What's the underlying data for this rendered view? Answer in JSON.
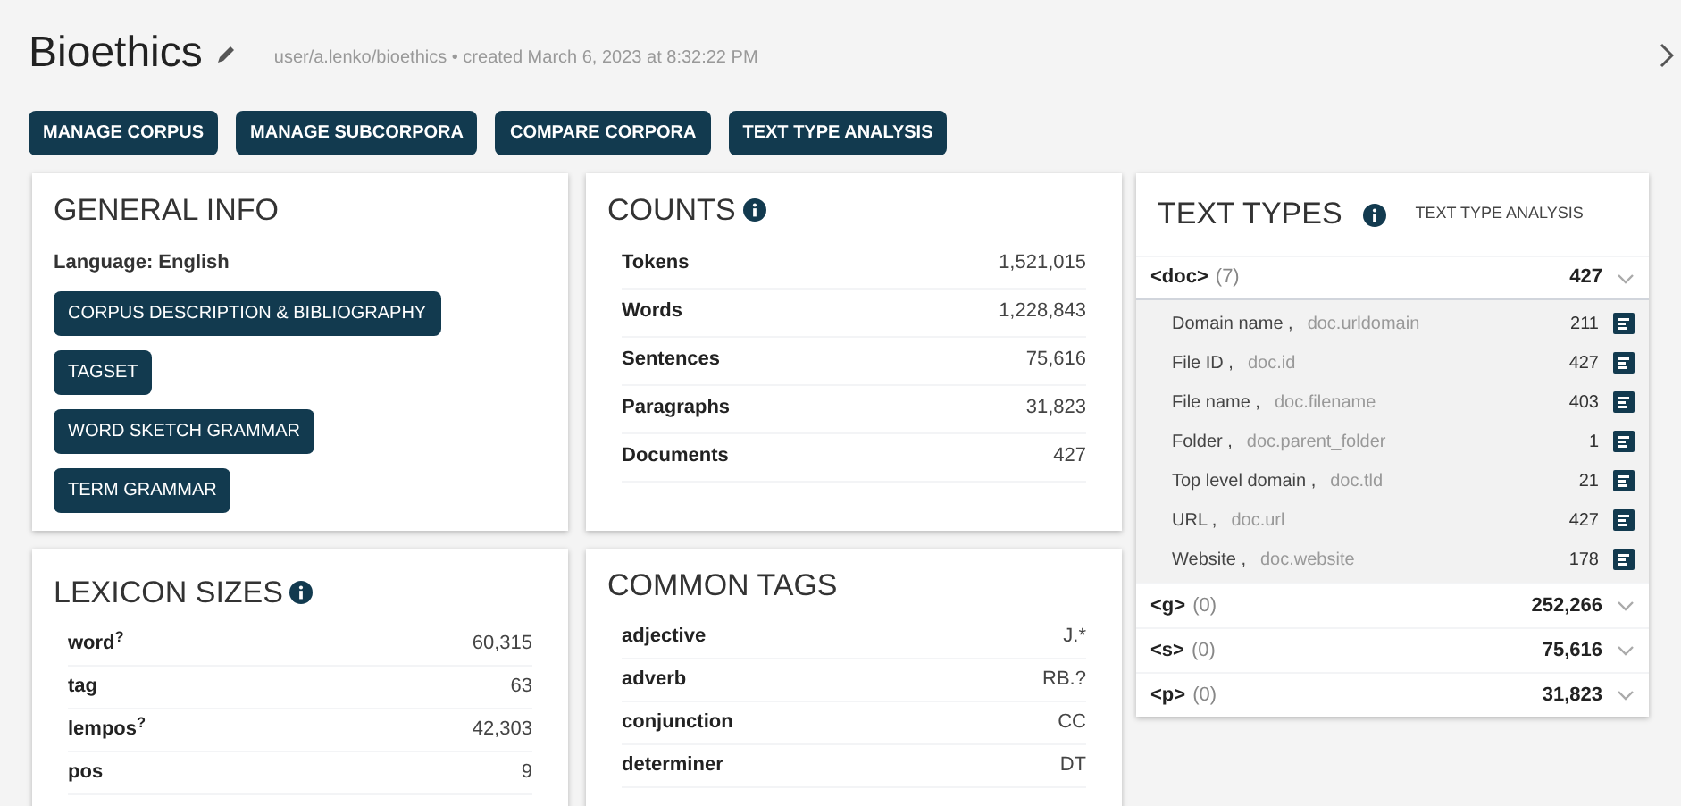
{
  "header": {
    "title": "Bioethics",
    "meta": "user/a.lenko/bioethics • created March 6, 2023 at 8:32:22 PM"
  },
  "actions": [
    "MANAGE CORPUS",
    "MANAGE SUBCORPORA",
    "COMPARE CORPORA",
    "TEXT TYPE ANALYSIS"
  ],
  "general_info": {
    "title": "GENERAL INFO",
    "language": "Language: English",
    "buttons": [
      "CORPUS DESCRIPTION & BIBLIOGRAPHY",
      "TAGSET",
      "WORD SKETCH GRAMMAR",
      "TERM GRAMMAR"
    ]
  },
  "counts": {
    "title": "COUNTS",
    "rows": [
      {
        "label": "Tokens",
        "value": "1,521,015"
      },
      {
        "label": "Words",
        "value": "1,228,843"
      },
      {
        "label": "Sentences",
        "value": "75,616"
      },
      {
        "label": "Paragraphs",
        "value": "31,823"
      },
      {
        "label": "Documents",
        "value": "427"
      }
    ]
  },
  "lexicon_sizes": {
    "title": "LEXICON SIZES",
    "rows": [
      {
        "label": "word$^{?}$",
        "value": "60,315"
      },
      {
        "label": "tag",
        "value": "63"
      },
      {
        "label": "lempos$^{?}$",
        "value": "42,303"
      },
      {
        "label": "pos",
        "value": "9"
      }
    ]
  },
  "common_tags": {
    "title": "COMMON TAGS",
    "rows": [
      {
        "label": "adjective",
        "value": "J.*"
      },
      {
        "label": "adverb",
        "value": "RB.?"
      },
      {
        "label": "conjunction",
        "value": "CC"
      },
      {
        "label": "determiner",
        "value": "DT"
      }
    ]
  },
  "text_types": {
    "title": "TEXT TYPES",
    "link": "TEXT TYPE ANALYSIS",
    "structures": [
      {
        "name": "<doc>",
        "count": "(7)",
        "total": "427",
        "expanded": true,
        "children": [
          {
            "label": "Domain name ,",
            "attr": "doc.urldomain",
            "value": "211"
          },
          {
            "label": "File ID ,",
            "attr": "doc.id",
            "value": "427"
          },
          {
            "label": "File name ,",
            "attr": "doc.filename",
            "value": "403"
          },
          {
            "label": "Folder ,",
            "attr": "doc.parent_folder",
            "value": "1"
          },
          {
            "label": "Top level domain ,",
            "attr": "doc.tld",
            "value": "21"
          },
          {
            "label": "URL ,",
            "attr": "doc.url",
            "value": "427"
          },
          {
            "label": "Website ,",
            "attr": "doc.website",
            "value": "178"
          }
        ]
      },
      {
        "name": "<g>",
        "count": "(0)",
        "total": "252,266",
        "expanded": false
      },
      {
        "name": "<s>",
        "count": "(0)",
        "total": "75,616",
        "expanded": false
      },
      {
        "name": "<p>",
        "count": "(0)",
        "total": "31,823",
        "expanded": false
      }
    ]
  }
}
